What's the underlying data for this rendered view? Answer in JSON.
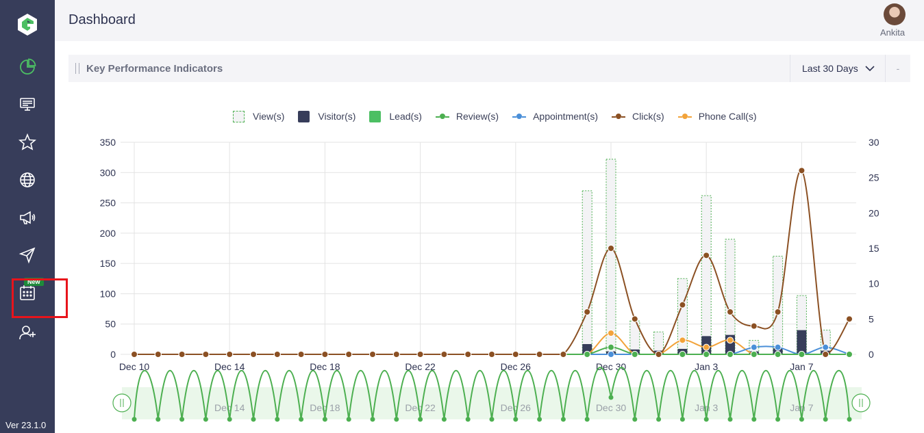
{
  "sidebar": {
    "items": [
      "dashboard-icon",
      "monitor-icon",
      "star-icon",
      "globe-icon",
      "megaphone-icon",
      "send-icon",
      "calendar-icon",
      "add-user-icon"
    ],
    "new_badge": "New",
    "version": "Ver 23.1.0"
  },
  "header": {
    "title": "Dashboard",
    "user_name": "Ankita"
  },
  "kpi": {
    "title": "Key Performance Indicators",
    "range_label": "Last 30 Days",
    "dash": "-"
  },
  "legend": {
    "views": "View(s)",
    "visitors": "Visitor(s)",
    "leads": "Lead(s)",
    "reviews": "Review(s)",
    "appointments": "Appointment(s)",
    "clicks": "Click(s)",
    "phone_calls": "Phone Call(s)"
  },
  "colors": {
    "sidebar": "#373d5a",
    "views": "#4caf50",
    "visitors": "#373d5a",
    "leads": "#4cbf63",
    "reviews": "#4caf50",
    "appointments": "#4a8fd8",
    "clicks": "#8b5023",
    "phone_calls": "#f2a33a",
    "highlight": "#e8141b"
  },
  "chart_data": {
    "type": "bar",
    "x": [
      "Dec 10",
      "Dec 11",
      "Dec 12",
      "Dec 13",
      "Dec 14",
      "Dec 15",
      "Dec 16",
      "Dec 17",
      "Dec 18",
      "Dec 19",
      "Dec 20",
      "Dec 21",
      "Dec 22",
      "Dec 23",
      "Dec 24",
      "Dec 25",
      "Dec 26",
      "Dec 27",
      "Dec 28",
      "Dec 29",
      "Dec 30",
      "Dec 31",
      "Jan 1",
      "Jan 2",
      "Jan 3",
      "Jan 4",
      "Jan 5",
      "Jan 6",
      "Jan 7",
      "Jan 8",
      "Jan 9"
    ],
    "x_tick_labels": [
      "Dec 10",
      "Dec 14",
      "Dec 18",
      "Dec 22",
      "Dec 26",
      "Dec 30",
      "Jan 3",
      "Jan 7"
    ],
    "ylim_left": [
      0,
      350
    ],
    "yticks_left": [
      0,
      50,
      100,
      150,
      200,
      250,
      300,
      350
    ],
    "ylim_right": [
      0,
      30
    ],
    "yticks_right": [
      0,
      5,
      10,
      15,
      20,
      25,
      30
    ],
    "series": [
      {
        "name": "View(s)",
        "kind": "bar",
        "axis": "left",
        "values": [
          0,
          0,
          0,
          0,
          0,
          0,
          0,
          0,
          0,
          0,
          0,
          0,
          0,
          0,
          0,
          0,
          0,
          0,
          0,
          270,
          322,
          55,
          37,
          125,
          262,
          190,
          23,
          162,
          97,
          40,
          0
        ]
      },
      {
        "name": "Visitor(s)",
        "kind": "bar",
        "axis": "left",
        "values": [
          0,
          0,
          0,
          0,
          0,
          0,
          0,
          0,
          0,
          0,
          0,
          0,
          0,
          0,
          0,
          0,
          0,
          0,
          0,
          17,
          5,
          8,
          6,
          9,
          30,
          32,
          5,
          10,
          40,
          6,
          0
        ]
      },
      {
        "name": "Lead(s)",
        "kind": "bar",
        "axis": "left",
        "values": [
          0,
          0,
          0,
          0,
          0,
          0,
          0,
          0,
          0,
          0,
          0,
          0,
          0,
          0,
          0,
          0,
          0,
          0,
          0,
          0,
          0,
          0,
          0,
          0,
          0,
          0,
          0,
          0,
          0,
          0,
          0
        ]
      },
      {
        "name": "Review(s)",
        "kind": "line",
        "axis": "right",
        "values": [
          0,
          0,
          0,
          0,
          0,
          0,
          0,
          0,
          0,
          0,
          0,
          0,
          0,
          0,
          0,
          0,
          0,
          0,
          0,
          0,
          1,
          0,
          0,
          0,
          0,
          0,
          0,
          0,
          0,
          0,
          0
        ]
      },
      {
        "name": "Appointment(s)",
        "kind": "line",
        "axis": "right",
        "values": [
          0,
          0,
          0,
          0,
          0,
          0,
          0,
          0,
          0,
          0,
          0,
          0,
          0,
          0,
          0,
          0,
          0,
          0,
          0,
          0,
          0,
          0,
          0,
          0,
          0,
          0,
          1,
          1,
          0,
          1,
          0
        ]
      },
      {
        "name": "Click(s)",
        "kind": "line",
        "axis": "right",
        "values": [
          0,
          0,
          0,
          0,
          0,
          0,
          0,
          0,
          0,
          0,
          0,
          0,
          0,
          0,
          0,
          0,
          0,
          0,
          0,
          6,
          15,
          5,
          0,
          7,
          14,
          6,
          4,
          6,
          26,
          0,
          5
        ]
      },
      {
        "name": "Phone Call(s)",
        "kind": "line",
        "axis": "right",
        "values": [
          0,
          0,
          0,
          0,
          0,
          0,
          0,
          0,
          0,
          0,
          0,
          0,
          0,
          0,
          0,
          0,
          0,
          0,
          0,
          0,
          3,
          0,
          0,
          2,
          1,
          2,
          0,
          0,
          0,
          0,
          0
        ]
      }
    ],
    "navigator": {
      "series": "Review(s)",
      "labels": [
        "Dec 14",
        "Dec 18",
        "Dec 22",
        "Dec 26",
        "Dec 30",
        "Jan 3",
        "Jan 7"
      ]
    }
  }
}
